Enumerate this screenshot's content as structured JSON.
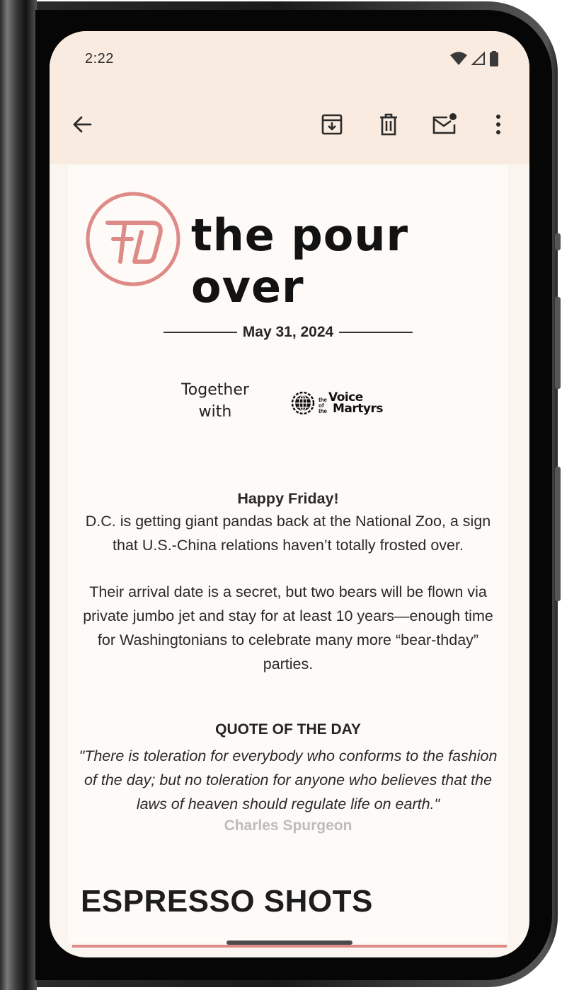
{
  "status_bar": {
    "time": "2:22",
    "icons": [
      "wifi-icon",
      "cell-signal-icon",
      "battery-icon"
    ]
  },
  "toolbar": {
    "back_icon": "arrow-left-icon",
    "archive_icon": "archive-icon",
    "delete_icon": "trash-icon",
    "mark_unread_icon": "mail-unread-icon",
    "more_icon": "more-vert-icon"
  },
  "email": {
    "logo_text": "the pour over",
    "date": "May 31, 2024",
    "sponsor": {
      "together_line1": "Together",
      "together_line2": "with",
      "logo_small1": "the",
      "logo_big1": "Voice",
      "logo_small2": "of the",
      "logo_big2": "Martyrs"
    },
    "greeting": "Happy Friday!",
    "para1": "D.C. is getting giant pandas back at the National Zoo, a sign that U.S.-China relations haven’t totally frosted over.",
    "para2": "Their arrival date is a secret, but two bears will be flown via private jumbo jet and stay for at least 10 years—enough time for Washingtonians to celebrate many more “bear-thday” parties.",
    "quote_heading": "QUOTE OF THE DAY",
    "quote": "\"There is toleration for everybody who conforms to the fashion of the day; but no toleration for anyone who believes that the laws of heaven should regulate life on earth.\"",
    "quote_author": "Charles Spurgeon",
    "section_title": "ESPRESSO SHOTS"
  },
  "colors": {
    "accent": "#de8a86",
    "appbar_bg": "#f9ebe0",
    "content_bg": "#fdfaf7"
  }
}
